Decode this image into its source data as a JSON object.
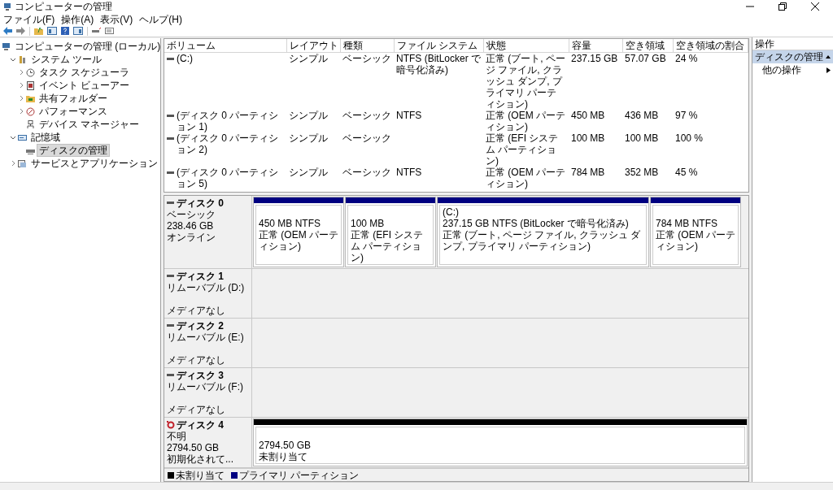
{
  "window": {
    "title": "コンピューターの管理"
  },
  "menu": [
    "ファイル(F)",
    "操作(A)",
    "表示(V)",
    "ヘルプ(H)"
  ],
  "tree": [
    {
      "label": "コンピューターの管理 (ローカル)",
      "selected": false,
      "children": [
        {
          "label": "システム ツール",
          "expanded": true,
          "selected": false,
          "children": [
            {
              "label": "タスク スケジューラ",
              "expanded": false,
              "selected": false
            },
            {
              "label": "イベント ビューアー",
              "expanded": false,
              "selected": false
            },
            {
              "label": "共有フォルダー",
              "expanded": false,
              "selected": false
            },
            {
              "label": "パフォーマンス",
              "expanded": false,
              "selected": false
            },
            {
              "label": "デバイス マネージャー",
              "selected": false
            }
          ]
        },
        {
          "label": "記憶域",
          "expanded": true,
          "selected": false,
          "children": [
            {
              "label": "ディスクの管理",
              "selected": true
            }
          ]
        },
        {
          "label": "サービスとアプリケーション",
          "expanded": false,
          "selected": false
        }
      ]
    }
  ],
  "table": {
    "columns": [
      "ボリューム",
      "レイアウト",
      "種類",
      "ファイル システム",
      "状態",
      "容量",
      "空き領域",
      "空き領域の割合"
    ],
    "rows": [
      [
        "(C:)",
        "シンプル",
        "ベーシック",
        "NTFS (BitLocker で暗号化済み)",
        "正常 (ブート, ページ ファイル, クラッシュ ダンプ, プライマリ パーティション)",
        "237.15 GB",
        "57.07 GB",
        "24 %"
      ],
      [
        "(ディスク 0 パーティション 1)",
        "シンプル",
        "ベーシック",
        "NTFS",
        "正常 (OEM パーティション)",
        "450 MB",
        "436 MB",
        "97 %"
      ],
      [
        "(ディスク 0 パーティション 2)",
        "シンプル",
        "ベーシック",
        null,
        "正常 (EFI システム パーティション)",
        "100 MB",
        "100 MB",
        "100 %"
      ],
      [
        "(ディスク 0 パーティション 5)",
        "シンプル",
        "ベーシック",
        "NTFS",
        "正常 (OEM パーティション)",
        "784 MB",
        "352 MB",
        "45 %"
      ]
    ]
  },
  "disks": [
    {
      "name": "ディスク 0",
      "alert": false,
      "type": "ベーシック",
      "size": "238.46 GB",
      "status": "オンライン",
      "partitions": [
        {
          "kind": "primary",
          "size": "450 MB NTFS",
          "status": "正常 (OEM パーティション)"
        },
        {
          "kind": "primary",
          "size": "100 MB",
          "status": "正常 (EFI システム パーティション)"
        },
        {
          "kind": "primary",
          "label": "(C:)",
          "size": "237.15 GB NTFS (BitLocker で暗号化済み)",
          "status": "正常 (ブート, ページ ファイル, クラッシュ ダンプ, プライマリ パーティション)"
        },
        {
          "kind": "primary",
          "size": "784 MB NTFS",
          "status": "正常 (OEM パーティション)"
        }
      ]
    },
    {
      "name": "ディスク 1",
      "alert": false,
      "type": "リムーバブル (D:)",
      "status": "メディアなし"
    },
    {
      "name": "ディスク 2",
      "alert": false,
      "type": "リムーバブル (E:)",
      "status": "メディアなし"
    },
    {
      "name": "ディスク 3",
      "alert": false,
      "type": "リムーバブル (F:)",
      "status": "メディアなし"
    },
    {
      "name": "ディスク 4",
      "alert": true,
      "type": "不明",
      "size": "2794.50 GB",
      "status": "初期化されて...",
      "partitions": [
        {
          "kind": "unallocated",
          "size": "2794.50 GB",
          "status": "未割り当て"
        }
      ]
    }
  ],
  "legend": [
    {
      "label": "未割り当て",
      "color": "#000000"
    },
    {
      "label": "プライマリ パーティション",
      "color": "#000080"
    }
  ],
  "actions": {
    "title": "操作",
    "section": {
      "label": "ディスクの管理",
      "selected": true
    },
    "items": [
      "他の操作"
    ]
  }
}
